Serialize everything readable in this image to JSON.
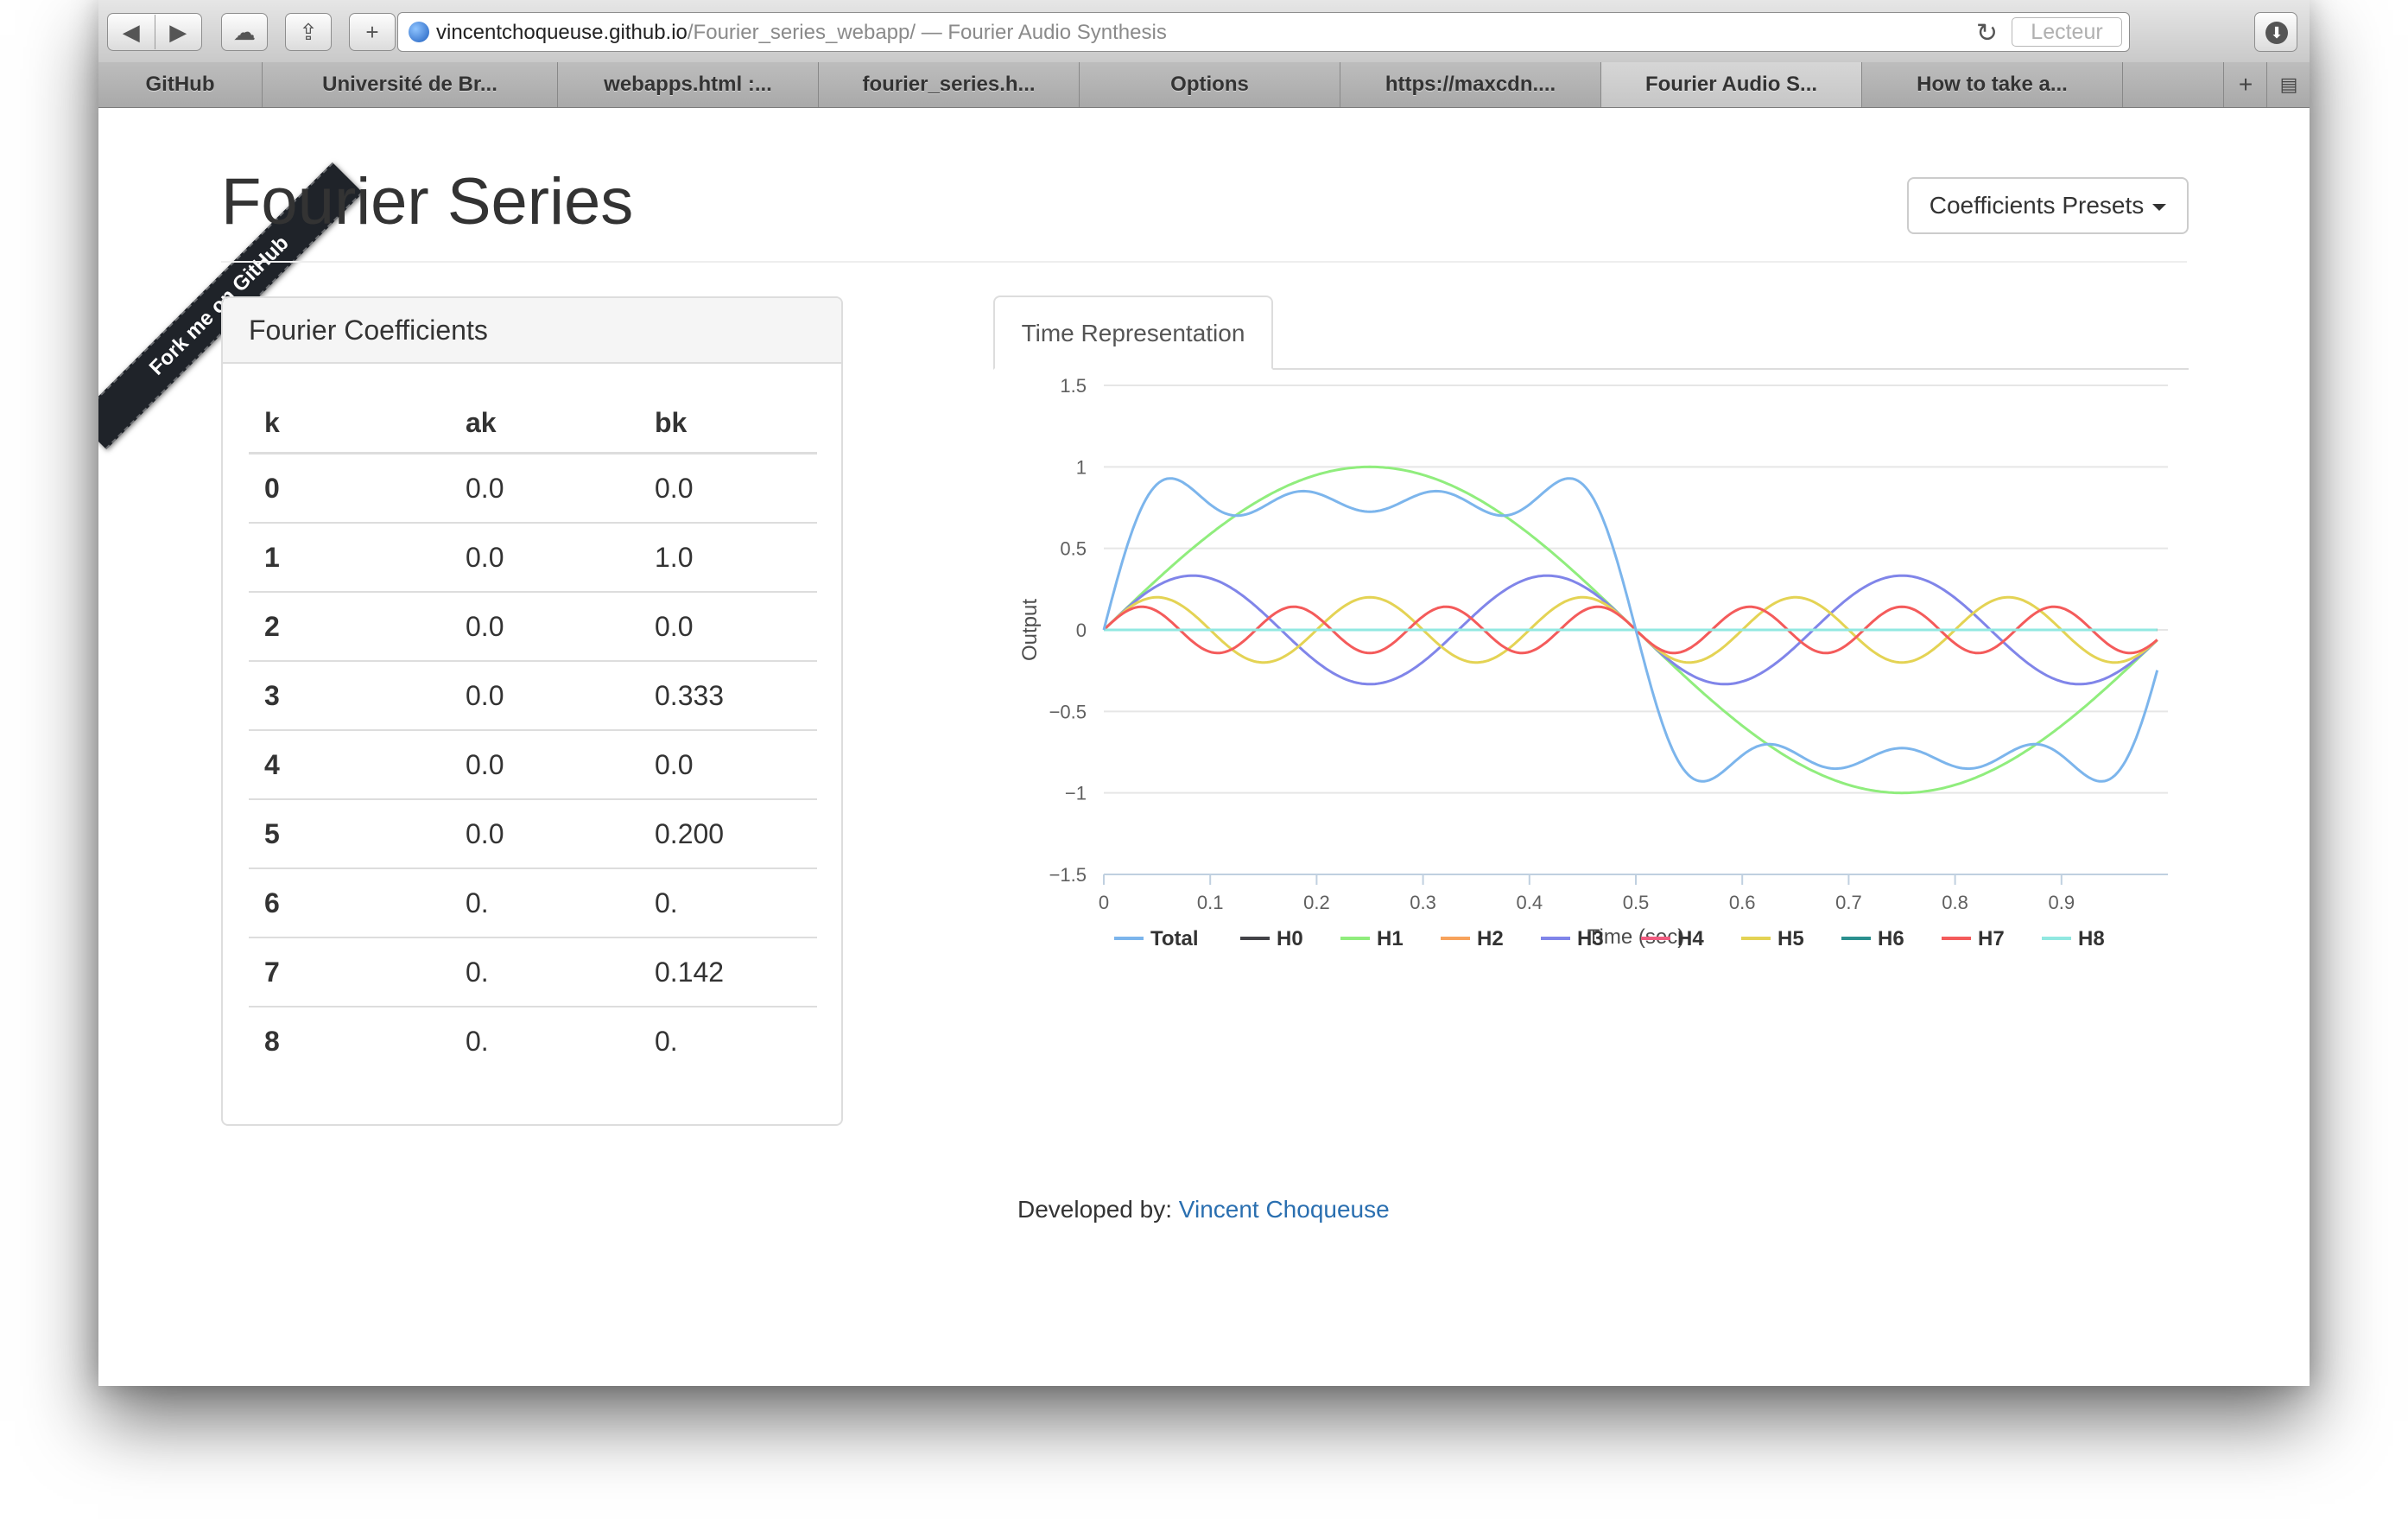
{
  "browser": {
    "url_host": "vincentchoqueuse.github.io",
    "url_path": "/Fourier_series_webapp/",
    "url_suffix": " — Fourier Audio Synthesis",
    "reader_label": "Lecteur",
    "tabs": [
      "GitHub",
      "Université de Br...",
      "webapps.html :...",
      "fourier_series.h...",
      "Options",
      "https://maxcdn....",
      "Fourier Audio S...",
      "How to take a..."
    ]
  },
  "ribbon": {
    "text": "Fork me on GitHub"
  },
  "header": {
    "title": "Fourier Series",
    "presets_label": "Coefficients Presets"
  },
  "coefficients": {
    "title": "Fourier Coefficients",
    "headers": [
      "k",
      "ak",
      "bk"
    ],
    "rows": [
      [
        "0",
        "0.0",
        "0.0"
      ],
      [
        "1",
        "0.0",
        "1.0"
      ],
      [
        "2",
        "0.0",
        "0.0"
      ],
      [
        "3",
        "0.0",
        "0.333"
      ],
      [
        "4",
        "0.0",
        "0.0"
      ],
      [
        "5",
        "0.0",
        "0.200"
      ],
      [
        "6",
        "0.",
        "0."
      ],
      [
        "7",
        "0.",
        "0.142"
      ],
      [
        "8",
        "0.",
        "0."
      ]
    ]
  },
  "chart_tab": {
    "label": "Time Representation"
  },
  "chart_data": {
    "type": "line",
    "title": "",
    "xlabel": "Time (sec)",
    "ylabel": "Output",
    "xlim": [
      0,
      1
    ],
    "ylim": [
      -1.5,
      1.5
    ],
    "x_ticks": [
      "0",
      "0.1",
      "0.2",
      "0.3",
      "0.4",
      "0.5",
      "0.6",
      "0.7",
      "0.8",
      "0.9"
    ],
    "y_ticks": [
      "1.5",
      "1",
      "0.5",
      "0",
      "−0.5",
      "−1",
      "−1.5"
    ],
    "grid": true,
    "legend_position": "bottom",
    "x": [
      0,
      0.1,
      0.2,
      0.3,
      0.4,
      0.5,
      0.6,
      0.7,
      0.8,
      0.9,
      0.99
    ],
    "series": [
      {
        "name": "Total",
        "color": "#7cb5ec",
        "bk": [
          1,
          0,
          0.333,
          0,
          0.2,
          0,
          0.142,
          0
        ],
        "values": [
          0,
          0.75,
          0.8,
          0.8,
          0.75,
          0,
          -0.75,
          -0.8,
          -0.8,
          -0.75,
          -0.25
        ]
      },
      {
        "name": "H0",
        "color": "#434348",
        "bk": [
          0
        ],
        "values": [
          0,
          0,
          0,
          0,
          0,
          0,
          0,
          0,
          0,
          0,
          0
        ]
      },
      {
        "name": "H1",
        "color": "#90ed7d",
        "bk": [
          1
        ],
        "values": [
          0,
          0.59,
          0.95,
          0.95,
          0.59,
          0,
          -0.59,
          -0.95,
          -0.95,
          -0.59,
          -0.06
        ]
      },
      {
        "name": "H2",
        "color": "#f7a35c",
        "bk": [
          0
        ],
        "values": [
          0,
          0,
          0,
          0,
          0,
          0,
          0,
          0,
          0,
          0,
          0
        ]
      },
      {
        "name": "H3",
        "color": "#8085e9",
        "bk": [
          0.333
        ],
        "values": [
          0,
          0.32,
          -0.2,
          -0.2,
          0.32,
          0,
          -0.32,
          0.2,
          0.2,
          -0.32,
          -0.06
        ]
      },
      {
        "name": "H4",
        "color": "#f15c80",
        "bk": [
          0
        ],
        "values": [
          0,
          0,
          0,
          0,
          0,
          0,
          0,
          0,
          0,
          0,
          0
        ]
      },
      {
        "name": "H5",
        "color": "#e4d354",
        "bk": [
          0.2
        ],
        "values": [
          0,
          0,
          0,
          0,
          0,
          0,
          0,
          0,
          0,
          0,
          -0.06
        ]
      },
      {
        "name": "H6",
        "color": "#2b908f",
        "bk": [
          0
        ],
        "values": [
          0,
          0,
          0,
          0,
          0,
          0,
          0,
          0,
          0,
          0,
          0
        ]
      },
      {
        "name": "H7",
        "color": "#f45b5b",
        "bk": [
          0.142
        ],
        "values": [
          0,
          0.08,
          0.13,
          -0.13,
          -0.08,
          0,
          0.08,
          0.13,
          -0.13,
          -0.08,
          -0.06
        ]
      },
      {
        "name": "H8",
        "color": "#91e8e1",
        "bk": [
          0
        ],
        "values": [
          0,
          0,
          0,
          0,
          0,
          0,
          0,
          0,
          0,
          0,
          0
        ]
      }
    ]
  },
  "footer": {
    "label": "Developed by:",
    "author": "Vincent Choqueuse"
  },
  "colors": {
    "link": "#2a6fb0",
    "grid": "#e6e6e6"
  }
}
